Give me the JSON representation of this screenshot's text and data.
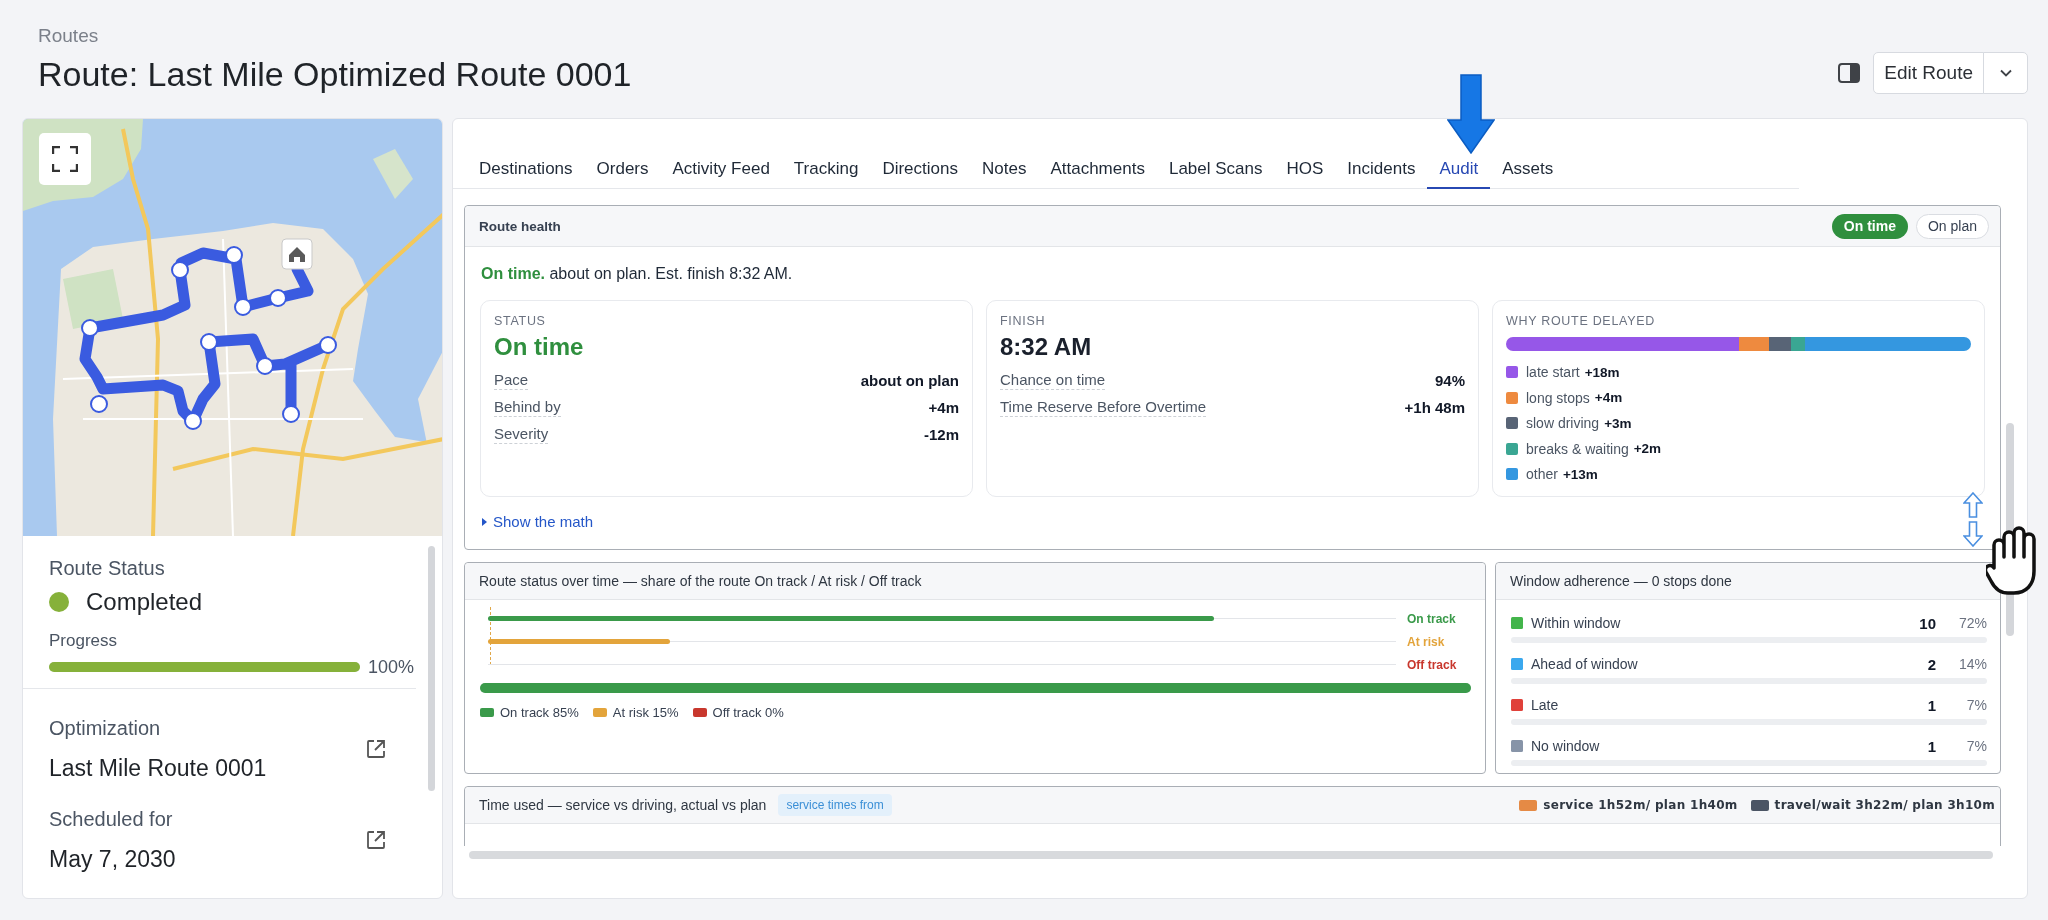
{
  "breadcrumb": "Routes",
  "title": "Route: Last Mile Optimized Route 0001",
  "actions": {
    "edit": "Edit Route"
  },
  "route_panel": {
    "status_label": "Route Status",
    "status": "Completed",
    "progress": {
      "label": "Progress",
      "level": 1,
      "reading": "100%"
    },
    "details": [
      {
        "label": "Optimization",
        "value": "Last Mile Route 0001"
      },
      {
        "label": "Scheduled for",
        "value": "May 7, 2030"
      }
    ]
  },
  "tabs": [
    {
      "label": "Destinations",
      "selected": false
    },
    {
      "label": "Orders",
      "selected": false
    },
    {
      "label": "Activity Feed",
      "selected": false
    },
    {
      "label": "Tracking",
      "selected": false
    },
    {
      "label": "Directions",
      "selected": false
    },
    {
      "label": "Notes",
      "selected": false
    },
    {
      "label": "Attachments",
      "selected": false
    },
    {
      "label": "Label Scans",
      "selected": false
    },
    {
      "label": "HOS",
      "selected": false
    },
    {
      "label": "Incidents",
      "selected": false
    },
    {
      "label": "Audit",
      "selected": true
    },
    {
      "label": "Assets",
      "selected": false
    }
  ],
  "route_health": {
    "title": "Route health",
    "badges": [
      {
        "label": "On time",
        "active": true
      },
      {
        "label": "On plan",
        "active": false
      }
    ],
    "summary": "**On time.** about on plan. Est. finish 8:32 AM.",
    "cards": [
      {
        "kind": "status",
        "label": "STATUS",
        "headline": "On time",
        "rows": [
          {
            "label": "Pace",
            "value": "about on plan"
          },
          {
            "label": "Behind by",
            "value": "+4m"
          },
          {
            "label": "Severity",
            "value": "-12m"
          }
        ]
      },
      {
        "kind": "finish",
        "label": "FINISH",
        "headline": "8:32 AM",
        "rows": [
          {
            "label": "Chance on time",
            "value": "94%"
          },
          {
            "label": "Time Reserve Before Overtime",
            "value": "+1h 48m"
          }
        ]
      },
      {
        "kind": "causes",
        "label": "WHY ROUTE DELAYED",
        "causes": [
          {
            "label": "late start",
            "value": "+18m",
            "color": "#9657e8"
          },
          {
            "label": "long stops",
            "value": "+4m",
            "color": "#ee8a3f"
          },
          {
            "label": "slow driving",
            "value": "+3m",
            "color": "#586476"
          },
          {
            "label": "breaks & waiting",
            "value": "+2m",
            "color": "#3aa693"
          },
          {
            "label": "other",
            "value": "+13m",
            "color": "#3497e0"
          }
        ]
      }
    ],
    "show_math": "Show the math"
  },
  "route_status": {
    "title": "Route status over time — share of the route On track / At risk / Off track",
    "tracks": [
      {
        "label": "On track",
        "color": "#3a9a4a",
        "level": 0.8
      },
      {
        "label": "At risk",
        "color": "#e3a43b",
        "level": 0.2
      },
      {
        "label": "Off track",
        "color": "#c8372d"
      }
    ],
    "share_bar": {
      "level": 1
    },
    "legend": [
      {
        "label": "On track 85%",
        "color": "#3a9a4a"
      },
      {
        "label": "At risk 15%",
        "color": "#e3a43b"
      },
      {
        "label": "Off track 0%",
        "color": "#c8372d"
      }
    ]
  },
  "window_adherence": {
    "title": "Window adherence — 0 stops done",
    "rows": [
      {
        "label": "Within window",
        "count": "10",
        "share": "72%",
        "color": "#43b54b"
      },
      {
        "label": "Ahead of window",
        "count": "2",
        "share": "14%",
        "color": "#3aa8ee"
      },
      {
        "label": "Late",
        "count": "1",
        "share": "7%",
        "color": "#e0413a"
      },
      {
        "label": "No window",
        "count": "1",
        "share": "7%",
        "color": "#8794a8"
      }
    ]
  },
  "time_used": {
    "title": "Time used — service vs driving, actual vs plan",
    "tag": "service times from",
    "legend": [
      {
        "label": "service 1h52m/ plan 1h40m",
        "color": "#e58a45"
      },
      {
        "label": "travel/wait 3h22m/ plan 3h10m",
        "color": "#4b5565"
      }
    ]
  }
}
